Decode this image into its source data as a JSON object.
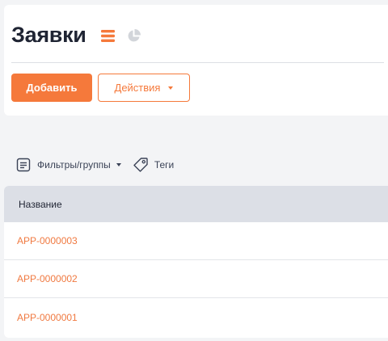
{
  "page": {
    "title": "Заявки",
    "view_icons": [
      "list-icon",
      "pie-chart-icon"
    ]
  },
  "toolbar": {
    "add_label": "Добавить",
    "actions_label": "Действия"
  },
  "filters": {
    "filters_label": "Фильтры/группы",
    "tags_label": "Теги"
  },
  "table": {
    "columns": [
      "Название"
    ],
    "rows": [
      {
        "name": "APP-0000003"
      },
      {
        "name": "APP-0000002"
      },
      {
        "name": "APP-0000001"
      }
    ]
  },
  "colors": {
    "accent": "#f5793b",
    "link": "#f07940",
    "header_bg": "#dcdfe6",
    "page_bg": "#f3f4f6"
  }
}
